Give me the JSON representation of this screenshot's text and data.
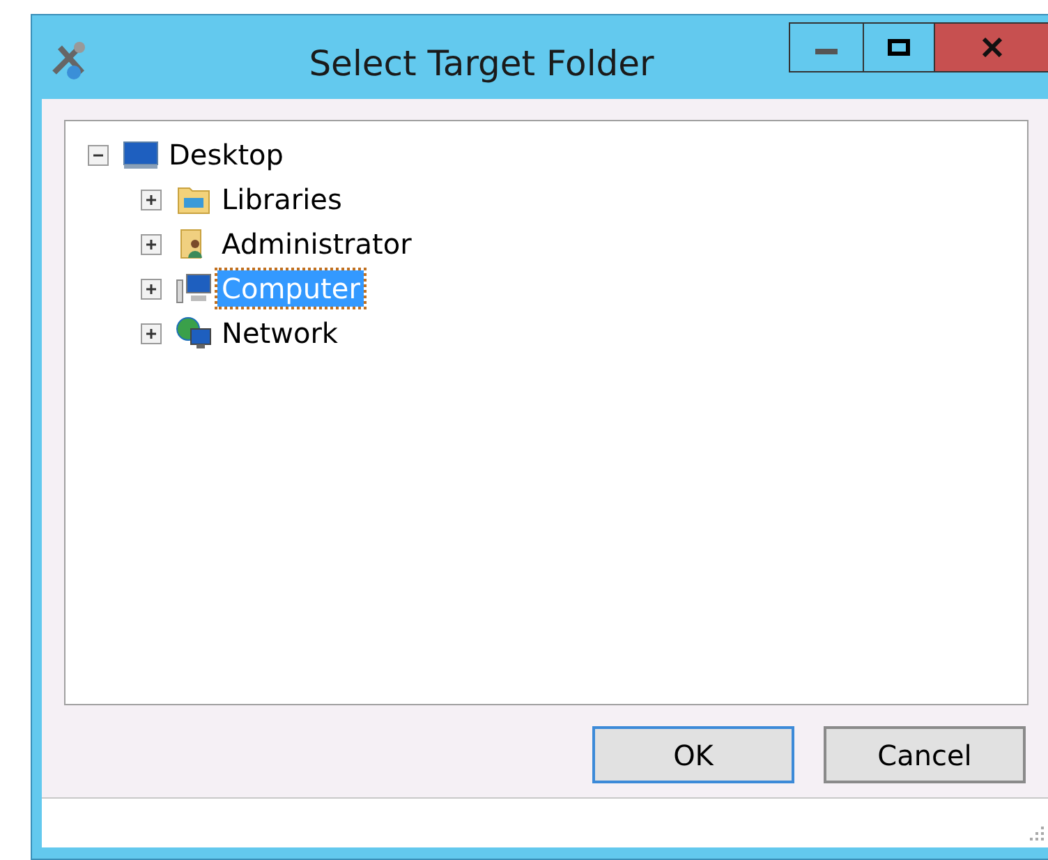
{
  "window": {
    "title": "Select Target Folder"
  },
  "tree": [
    {
      "label": "Desktop",
      "kind": "desktop",
      "expanded": true,
      "selected": false,
      "children": [
        {
          "label": "Libraries",
          "kind": "libraries",
          "expanded": false,
          "selected": false
        },
        {
          "label": "Administrator",
          "kind": "user",
          "expanded": false,
          "selected": false
        },
        {
          "label": "Computer",
          "kind": "computer",
          "expanded": false,
          "selected": true
        },
        {
          "label": "Network",
          "kind": "network",
          "expanded": false,
          "selected": false
        }
      ]
    }
  ],
  "buttons": [
    {
      "label": "OK",
      "default": true
    },
    {
      "label": "Cancel",
      "default": false
    }
  ]
}
